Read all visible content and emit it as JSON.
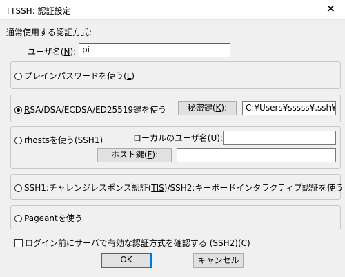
{
  "window": {
    "title": "TTSSH: 認証設定"
  },
  "icons": {
    "close": "close-icon"
  },
  "colors": {
    "accent": "#0078d7",
    "background": "#f0f0f0",
    "button": "#e1e1e1"
  },
  "auth": {
    "section_label": "通常使用する認証方式:",
    "username": {
      "label": "ユーザ名(",
      "accel": "N",
      "label_end": "):",
      "value": "pi"
    },
    "options": {
      "password": {
        "label_pre": "プレインパスワードを使う(",
        "accel": "L",
        "label_post": ")",
        "selected": false
      },
      "rsa": {
        "label_pre": "",
        "accel": "R",
        "label_post": "SA/DSA/ECDSA/ED25519鍵を使う",
        "selected": true,
        "private_key_button": {
          "pre": "秘密鍵(",
          "accel": "K",
          "post": "):"
        },
        "private_key_path": "C:¥Users¥sssss¥.ssh¥id_r"
      },
      "rhosts": {
        "label_pre": "r",
        "accel": "h",
        "label_post": "ostsを使う(SSH1)",
        "selected": false,
        "local_user": {
          "pre": "ローカルのユーザ名(",
          "accel": "U",
          "post": "):",
          "value": ""
        },
        "host_key_button": {
          "pre": "ホスト鍵(",
          "accel": "F",
          "post": "):"
        },
        "host_key_value": ""
      },
      "keyboard_interactive": {
        "label_pre": "SSH1:チャレンジレスポンス認証(",
        "accel": "TIS",
        "label_post": ")/SSH2:キーボードインタラクティブ認証を使う",
        "selected": false
      },
      "pageant": {
        "label_pre": "P",
        "accel": "a",
        "label_post": "geantを使う",
        "selected": false
      }
    },
    "check_methods": {
      "label_pre": "ログイン前にサーバで有効な認証方式を確認する (SSH2)(",
      "accel": "C",
      "label_post": ")",
      "checked": false
    }
  },
  "buttons": {
    "ok": "OK",
    "cancel": "キャンセル"
  }
}
